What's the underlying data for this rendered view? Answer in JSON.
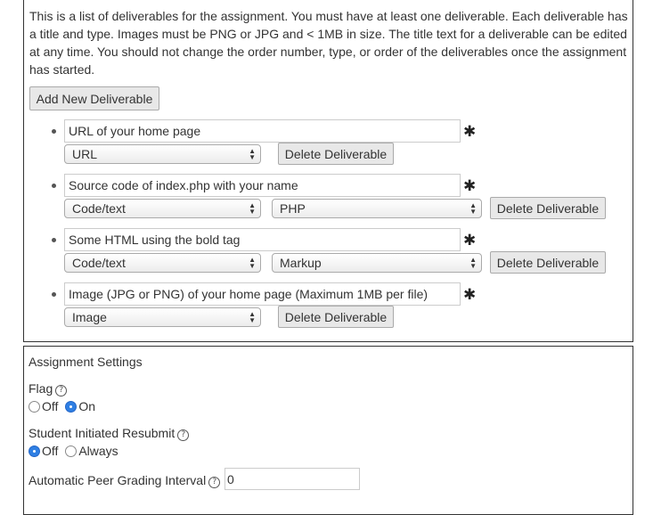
{
  "intro_text": "This is a list of deliverables for the assignment. You must have at least one deliverable. Each deliverable has a title and type. Images must be PNG or JPG and < 1MB in size. The title text for a deliverable can be edited at any time. You should not change the order number, type, or order of the deliverables once the assignment has started.",
  "add_button_label": "Add New Deliverable",
  "required_mark": "✱",
  "deliverables": [
    {
      "title": "URL of your home page",
      "type": "URL",
      "subtype": null,
      "delete_label": "Delete Deliverable"
    },
    {
      "title": "Source code of index.php with your name",
      "type": "Code/text",
      "subtype": "PHP",
      "delete_label": "Delete Deliverable"
    },
    {
      "title": "Some HTML using the bold tag",
      "type": "Code/text",
      "subtype": "Markup",
      "delete_label": "Delete Deliverable"
    },
    {
      "title": "Image (JPG or PNG) of your home page (Maximum 1MB per file)",
      "type": "Image",
      "subtype": null,
      "delete_label": "Delete Deliverable"
    }
  ],
  "settings": {
    "heading": "Assignment Settings",
    "flag": {
      "label": "Flag",
      "options": [
        "Off",
        "On"
      ],
      "selected": "On"
    },
    "resubmit": {
      "label": "Student Initiated Resubmit",
      "options": [
        "Off",
        "Always"
      ],
      "selected": "Off"
    },
    "peer_interval": {
      "label": "Automatic Peer Grading Interval",
      "value": "0"
    }
  },
  "icons": {
    "help": "help-circle-icon",
    "required": "asterisk-icon",
    "select_arrows": "updown-chevron-icon"
  },
  "colors": {
    "radio_selected": "#2f7fe3",
    "button_bg": "#e8e8e8"
  }
}
